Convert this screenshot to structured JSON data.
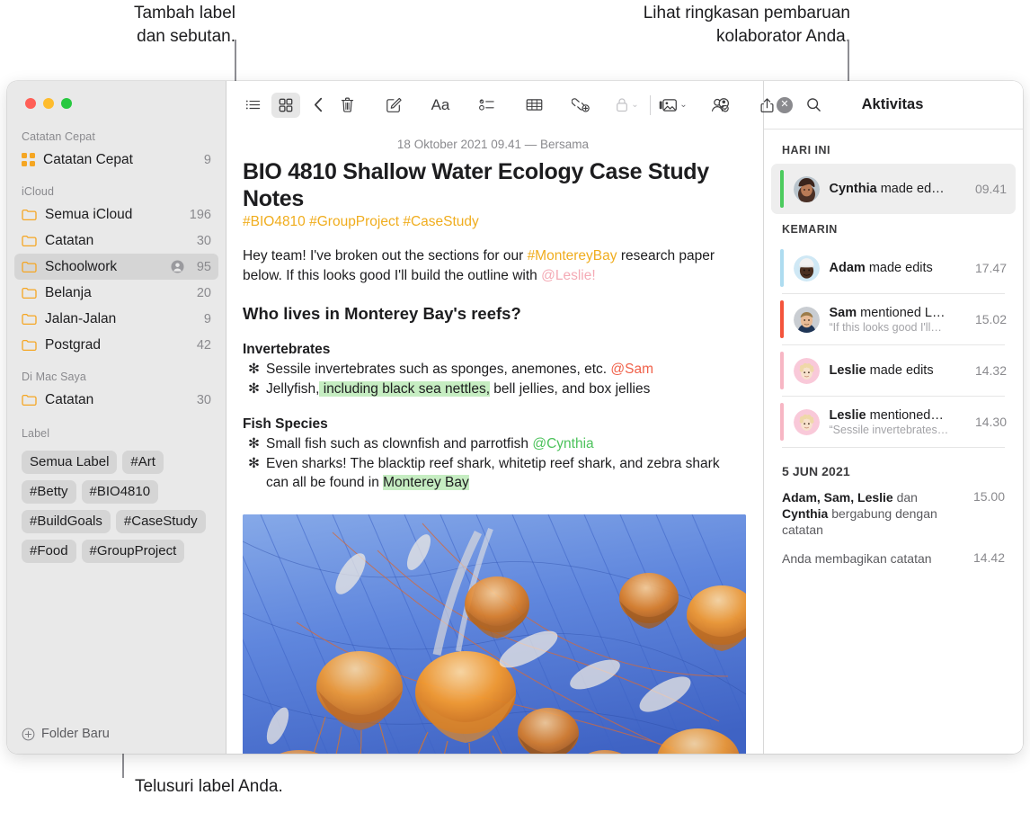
{
  "callouts": {
    "tags": "Tambah label\ndan sebutan.",
    "activity": "Lihat ringkasan pembaruan\nkolaborator Anda.",
    "browse": "Telusuri label Anda."
  },
  "window": {
    "traffic_lights": [
      "close-button",
      "minimize-button",
      "zoom-button"
    ]
  },
  "sidebar": {
    "sections": [
      {
        "title": "Catatan Cepat",
        "rows": [
          {
            "icon": "quick-note-icon",
            "label": "Catatan Cepat",
            "count": "9",
            "shared": false,
            "selected": false
          }
        ]
      },
      {
        "title": "iCloud",
        "rows": [
          {
            "icon": "folder-icon",
            "label": "Semua iCloud",
            "count": "196",
            "shared": false,
            "selected": false
          },
          {
            "icon": "folder-icon",
            "label": "Catatan",
            "count": "30",
            "shared": false,
            "selected": false
          },
          {
            "icon": "folder-icon",
            "label": "Schoolwork",
            "count": "95",
            "shared": true,
            "selected": true
          },
          {
            "icon": "folder-icon",
            "label": "Belanja",
            "count": "20",
            "shared": false,
            "selected": false
          },
          {
            "icon": "folder-icon",
            "label": "Jalan-Jalan",
            "count": "9",
            "shared": false,
            "selected": false
          },
          {
            "icon": "folder-icon",
            "label": "Postgrad",
            "count": "42",
            "shared": false,
            "selected": false
          }
        ]
      },
      {
        "title": "Di Mac Saya",
        "rows": [
          {
            "icon": "folder-icon",
            "label": "Catatan",
            "count": "30",
            "shared": false,
            "selected": false
          }
        ]
      }
    ],
    "tags_title": "Label",
    "tags": [
      "Semua Label",
      "#Art",
      "#Betty",
      "#BIO4810",
      "#BuildGoals",
      "#CaseStudy",
      "#Food",
      "#GroupProject"
    ],
    "footer": {
      "icon": "plus-circle-icon",
      "label": "Folder Baru"
    }
  },
  "toolbar": {
    "left": [
      {
        "name": "list-view-icon",
        "active": false
      },
      {
        "name": "gallery-view-icon",
        "active": true
      },
      {
        "name": "back-chevron-icon",
        "active": false
      }
    ],
    "center": [
      {
        "name": "trash-icon"
      },
      {
        "name": "compose-icon"
      },
      {
        "name": "format-aa-icon"
      },
      {
        "name": "checklist-icon"
      },
      {
        "name": "table-icon"
      },
      {
        "name": "add-link-icon"
      },
      {
        "name": "lock-icon",
        "dimmed": true,
        "has_chevron": true
      }
    ],
    "right": [
      {
        "name": "media-icon",
        "has_chevron": true
      },
      {
        "name": "add-collaborator-icon"
      },
      {
        "name": "share-icon"
      },
      {
        "name": "search-icon"
      }
    ]
  },
  "note": {
    "date_line": "18 Oktober 2021 09.41 — Bersama",
    "title": "BIO 4810 Shallow Water Ecology Case Study Notes",
    "tags_line": "#BIO4810 #GroupProject #CaseStudy",
    "intro": {
      "part1": "Hey team! I've broken out the sections for our ",
      "tag": "#MontereyBay",
      "part2": " research paper below. If this looks good I'll build the outline with ",
      "mention": "@Leslie!"
    },
    "heading": "Who lives in Monterey Bay's reefs?",
    "groups": [
      {
        "subheading": "Invertebrates",
        "bullets": [
          {
            "marker": "✻",
            "text": "Sessile invertebrates such as sponges, anemones, etc. ",
            "mention": "@Sam",
            "mention_color": "#f0614a"
          },
          {
            "marker": "✻",
            "pre": "Jellyfish,",
            "highlight": " including black sea nettles,",
            "post": " bell jellies, and box jellies"
          }
        ]
      },
      {
        "subheading": "Fish Species",
        "bullets": [
          {
            "marker": "✻",
            "text": "Small fish such as clownfish and parrotfish ",
            "mention": "@Cynthia",
            "mention_color": "#4cc25b"
          },
          {
            "marker": "✻",
            "pre": "Even sharks! The blacktip reef shark, whitetip reef shark, and zebra shark can all be found in ",
            "highlight": "Monterey Bay",
            "post": ""
          }
        ]
      }
    ],
    "image_alt": "jellyfish-photo"
  },
  "activity": {
    "close_icon": "close-icon",
    "title": "Aktivitas",
    "groups": [
      {
        "label": "HARI INI",
        "type": "heading",
        "items": [
          {
            "bar_color": "#4ccb5e",
            "avatar": "cynthia-avatar",
            "name": "Cynthia",
            "action": " made ed…",
            "sub": "",
            "time": "09.41",
            "selected": true
          }
        ]
      },
      {
        "label": "KEMARIN",
        "type": "heading",
        "items": [
          {
            "bar_color": "#aedcf0",
            "avatar": "adam-avatar",
            "name": "Adam",
            "action": " made edits",
            "sub": "",
            "time": "17.47",
            "selected": false
          },
          {
            "bar_color": "#f4543c",
            "avatar": "sam-avatar",
            "name": "Sam",
            "action": " mentioned L…",
            "sub": "“If this looks good I'll…",
            "time": "15.02",
            "selected": false
          },
          {
            "bar_color": "#f7b6c4",
            "avatar": "leslie-avatar",
            "name": "Leslie",
            "action": " made edits",
            "sub": "",
            "time": "14.32",
            "selected": false
          },
          {
            "bar_color": "#f7b6c4",
            "avatar": "leslie-avatar",
            "name": "Leslie",
            "action": " mentioned…",
            "sub": "“Sessile invertebrates…",
            "time": "14.30",
            "selected": false
          }
        ]
      },
      {
        "label": "5 JUN 2021",
        "type": "date",
        "plain": [
          {
            "bold": "Adam, Sam, Leslie",
            "mid": " dan ",
            "bold2": "Cynthia",
            "rest": " bergabung dengan catatan",
            "time": "15.00"
          },
          {
            "bold": "",
            "mid": "",
            "bold2": "",
            "rest": "Anda membagikan catatan",
            "time": "14.42"
          }
        ]
      }
    ]
  },
  "colors": {
    "accent_orange": "#f5a623",
    "tag_yellow": "#f0ad1e",
    "highlight_green": "#c6edc2",
    "mention_red": "#f0614a",
    "mention_green": "#4cc25b",
    "mention_pink": "#f4aab5",
    "sidebar_bg": "#e9e9e9",
    "selected_bg": "#d5d5d5"
  }
}
